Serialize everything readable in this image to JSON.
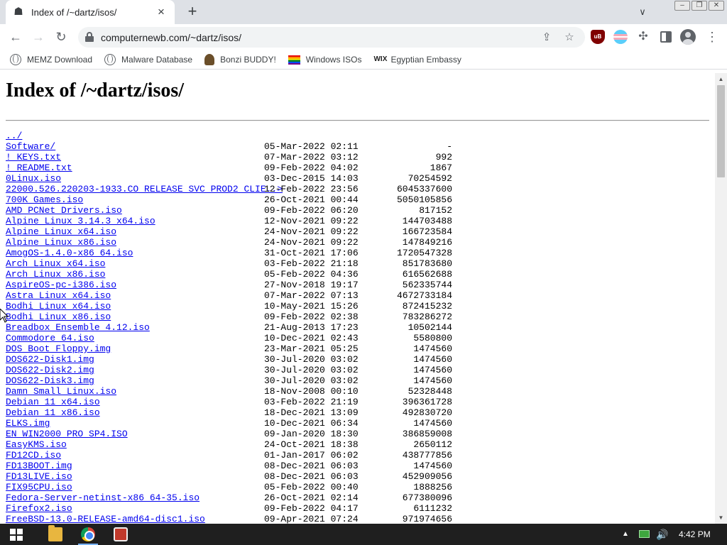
{
  "tab": {
    "title": "Index of /~dartz/isos/"
  },
  "omnibox": {
    "url": "computernewb.com/~dartz/isos/"
  },
  "bookmarks": [
    {
      "label": "MEMZ Download",
      "icon": "globe-icon"
    },
    {
      "label": "Malware Database",
      "icon": "globe-icon"
    },
    {
      "label": "Bonzi BUDDY!",
      "icon": "bonzi-icon"
    },
    {
      "label": "Windows ISOs",
      "icon": "rainbow-flag-icon"
    },
    {
      "label": "Egyptian Embassy",
      "icon": "wix-icon"
    }
  ],
  "page": {
    "title": "Index of /~dartz/isos/"
  },
  "listing": [
    {
      "name": "../",
      "date": "",
      "size": ""
    },
    {
      "name": "Software/",
      "date": "05-Mar-2022 02:11",
      "size": "-"
    },
    {
      "name": "! KEYS.txt",
      "date": "07-Mar-2022 03:12",
      "size": "992"
    },
    {
      "name": "! README.txt",
      "date": "09-Feb-2022 04:02",
      "size": "1867"
    },
    {
      "name": "0Linux.iso",
      "date": "03-Dec-2015 14:03",
      "size": "70254592"
    },
    {
      "name": "22000.526.220203-1933.CO_RELEASE_SVC_PROD2_CLIE..>",
      "date": "12-Feb-2022 23:56",
      "size": "6045337600"
    },
    {
      "name": "700K Games.iso",
      "date": "26-Oct-2021 00:44",
      "size": "5050105856"
    },
    {
      "name": "AMD PCNet Drivers.iso",
      "date": "09-Feb-2022 06:20",
      "size": "817152"
    },
    {
      "name": "Alpine Linux 3.14.3 x64.iso",
      "date": "12-Nov-2021 09:22",
      "size": "144703488"
    },
    {
      "name": "Alpine Linux x64.iso",
      "date": "24-Nov-2021 09:22",
      "size": "166723584"
    },
    {
      "name": "Alpine Linux x86.iso",
      "date": "24-Nov-2021 09:22",
      "size": "147849216"
    },
    {
      "name": "AmogOS-1.4.0-x86_64.iso",
      "date": "31-Oct-2021 17:06",
      "size": "1720547328"
    },
    {
      "name": "Arch Linux x64.iso",
      "date": "03-Feb-2022 21:18",
      "size": "851783680"
    },
    {
      "name": "Arch Linux x86.iso",
      "date": "05-Feb-2022 04:36",
      "size": "616562688"
    },
    {
      "name": "AspireOS-pc-i386.iso",
      "date": "27-Nov-2018 19:17",
      "size": "562335744"
    },
    {
      "name": "Astra Linux x64.iso",
      "date": "07-Mar-2022 07:13",
      "size": "4672733184"
    },
    {
      "name": "Bodhi Linux x64.iso",
      "date": "10-May-2021 15:26",
      "size": "872415232"
    },
    {
      "name": "Bodhi Linux x86.iso",
      "date": "09-Feb-2022 02:38",
      "size": "783286272"
    },
    {
      "name": "Breadbox Ensemble 4.12.iso",
      "date": "21-Aug-2013 17:23",
      "size": "10502144"
    },
    {
      "name": "Commodore 64.iso",
      "date": "10-Dec-2021 02:43",
      "size": "5580800"
    },
    {
      "name": "DOS Boot Floppy.img",
      "date": "23-Mar-2021 05:25",
      "size": "1474560"
    },
    {
      "name": "DOS622-Disk1.img",
      "date": "30-Jul-2020 03:02",
      "size": "1474560"
    },
    {
      "name": "DOS622-Disk2.img",
      "date": "30-Jul-2020 03:02",
      "size": "1474560"
    },
    {
      "name": "DOS622-Disk3.img",
      "date": "30-Jul-2020 03:02",
      "size": "1474560"
    },
    {
      "name": "Damn Small Linux.iso",
      "date": "18-Nov-2008 00:10",
      "size": "52328448"
    },
    {
      "name": "Debian 11 x64.iso",
      "date": "03-Feb-2022 21:19",
      "size": "396361728"
    },
    {
      "name": "Debian 11 x86.iso",
      "date": "18-Dec-2021 13:09",
      "size": "492830720"
    },
    {
      "name": "ELKS.img",
      "date": "10-Dec-2021 06:34",
      "size": "1474560"
    },
    {
      "name": "EN_WIN2000_PRO_SP4.ISO",
      "date": "09-Jan-2020 18:30",
      "size": "386859008"
    },
    {
      "name": "EasyKMS.iso",
      "date": "24-Oct-2021 18:38",
      "size": "2650112"
    },
    {
      "name": "FD12CD.iso",
      "date": "01-Jan-2017 06:02",
      "size": "438777856"
    },
    {
      "name": "FD13BOOT.img",
      "date": "08-Dec-2021 06:03",
      "size": "1474560"
    },
    {
      "name": "FD13LIVE.iso",
      "date": "08-Dec-2021 06:03",
      "size": "452909056"
    },
    {
      "name": "FIX95CPU.iso",
      "date": "05-Feb-2022 00:40",
      "size": "1888256"
    },
    {
      "name": "Fedora-Server-netinst-x86_64-35.iso",
      "date": "26-Oct-2021 02:14",
      "size": "677380096"
    },
    {
      "name": "Firefox2.iso",
      "date": "09-Feb-2022 04:17",
      "size": "6111232"
    },
    {
      "name": "FreeBSD-13.0-RELEASE-amd64-disc1.iso",
      "date": "09-Apr-2021 07:24",
      "size": "971974656"
    }
  ],
  "taskbar": {
    "clock": "4:42 PM"
  },
  "colors": {
    "link": "#0000ee",
    "taskbar": "#1f1f1f",
    "tabstrip": "#dee1e6"
  }
}
